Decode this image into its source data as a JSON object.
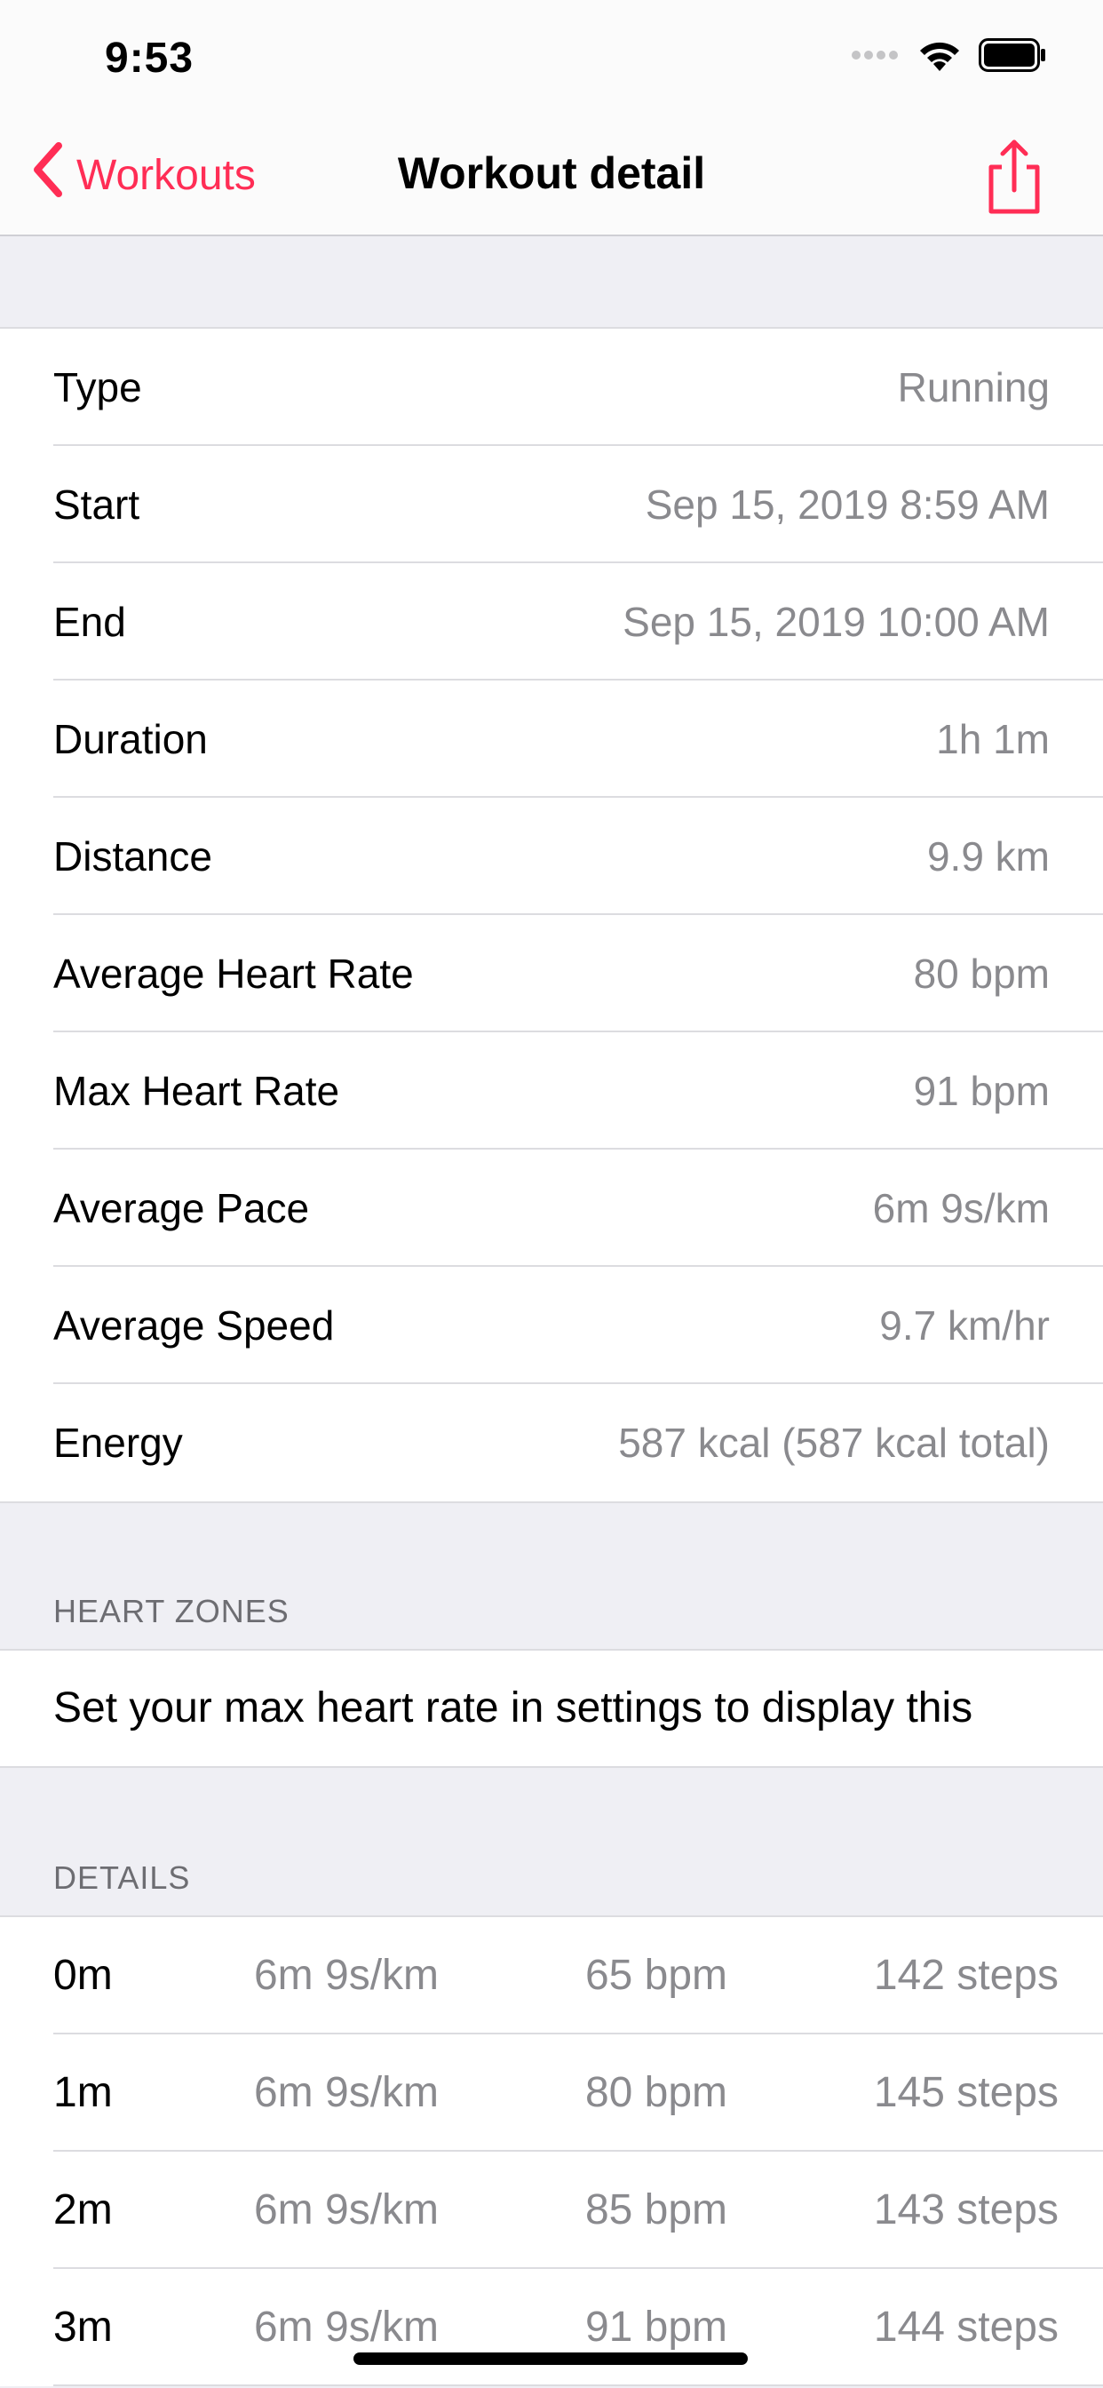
{
  "status_bar": {
    "time": "9:53"
  },
  "nav": {
    "back_label": "Workouts",
    "title": "Workout detail"
  },
  "summary": [
    {
      "label": "Type",
      "value": "Running"
    },
    {
      "label": "Start",
      "value": "Sep 15, 2019 8:59 AM"
    },
    {
      "label": "End",
      "value": "Sep 15, 2019 10:00 AM"
    },
    {
      "label": "Duration",
      "value": "1h 1m"
    },
    {
      "label": "Distance",
      "value": "9.9 km"
    },
    {
      "label": "Average Heart Rate",
      "value": "80 bpm"
    },
    {
      "label": "Max Heart Rate",
      "value": "91 bpm"
    },
    {
      "label": "Average Pace",
      "value": "6m 9s/km"
    },
    {
      "label": "Average Speed",
      "value": "9.7 km/hr"
    },
    {
      "label": "Energy",
      "value": "587 kcal (587 kcal total)"
    }
  ],
  "heart_zones": {
    "header": "HEART ZONES",
    "message": "Set your max heart rate in settings to display this"
  },
  "details": {
    "header": "DETAILS",
    "rows": [
      {
        "minute": "0m",
        "pace": "6m 9s/km",
        "heart_rate": "65 bpm",
        "steps": "142 steps"
      },
      {
        "minute": "1m",
        "pace": "6m 9s/km",
        "heart_rate": "80 bpm",
        "steps": "145 steps"
      },
      {
        "minute": "2m",
        "pace": "6m 9s/km",
        "heart_rate": "85 bpm",
        "steps": "143 steps"
      },
      {
        "minute": "3m",
        "pace": "6m 9s/km",
        "heart_rate": "91 bpm",
        "steps": "144 steps"
      }
    ]
  },
  "colors": {
    "accent": "#ff2d55",
    "secondary_text": "#8a8a8e",
    "grouped_background": "#efeff4"
  }
}
